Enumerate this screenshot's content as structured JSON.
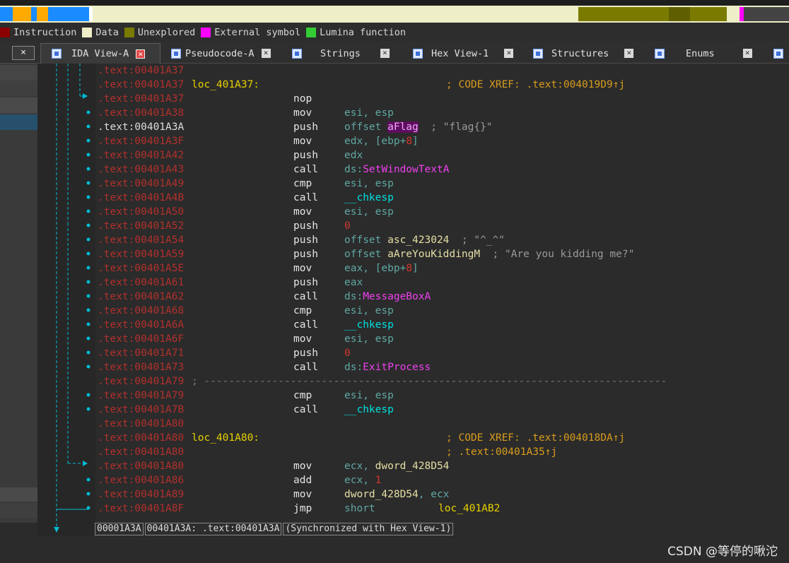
{
  "legend": [
    {
      "label": "Instruction",
      "color": "#8b0000"
    },
    {
      "label": "Data",
      "color": "#eeeec8"
    },
    {
      "label": "Unexplored",
      "color": "#7a7a00"
    },
    {
      "label": "External symbol",
      "color": "#ff00ff"
    },
    {
      "label": "Lumina function",
      "color": "#33cc33"
    }
  ],
  "left_close_label": "×",
  "tabs": [
    {
      "label": "IDA View-A",
      "active": true,
      "close": "×"
    },
    {
      "label": "Pseudocode-A",
      "active": false,
      "close": "×"
    },
    {
      "label": "Strings",
      "active": false,
      "close": "×"
    },
    {
      "label": "Hex View-1",
      "active": false,
      "close": "×"
    },
    {
      "label": "Structures",
      "active": false,
      "close": "×"
    },
    {
      "label": "Enums",
      "active": false,
      "close": "×"
    }
  ],
  "disasm": {
    "rows": [
      {
        "addr": ".text:00401A37"
      },
      {
        "addr": ".text:00401A37",
        "label": "loc_401A37:",
        "xref": "; CODE XREF: .text:004019D9↑j"
      },
      {
        "addr": ".text:00401A37",
        "mnem": "nop"
      },
      {
        "addr": ".text:00401A38",
        "mnem": "mov",
        "ops": "esi, esp"
      },
      {
        "addr": ".text:00401A3A",
        "mnem": "push",
        "ops_pre": "offset ",
        "ops_sym": "aFlag",
        "comment": "; \"flag{}\"",
        "current": true
      },
      {
        "addr": ".text:00401A3F",
        "mnem": "mov",
        "ops_pre": "edx, [ebp+",
        "ops_num": "8",
        "ops_post": "]"
      },
      {
        "addr": ".text:00401A42",
        "mnem": "push",
        "ops": "edx"
      },
      {
        "addr": ".text:00401A43",
        "mnem": "call",
        "ops_pre": "ds:",
        "ops_ext": "SetWindowTextA"
      },
      {
        "addr": ".text:00401A49",
        "mnem": "cmp",
        "ops": "esi, esp"
      },
      {
        "addr": ".text:00401A4B",
        "mnem": "call",
        "ops_fn": "__chkesp"
      },
      {
        "addr": ".text:00401A50",
        "mnem": "mov",
        "ops": "esi, esp"
      },
      {
        "addr": ".text:00401A52",
        "mnem": "push",
        "ops_num": "0"
      },
      {
        "addr": ".text:00401A54",
        "mnem": "push",
        "ops_pre": "offset ",
        "ops_sym": "asc_423024",
        "comment": "; \"^_^\""
      },
      {
        "addr": ".text:00401A59",
        "mnem": "push",
        "ops_pre": "offset ",
        "ops_sym": "aAreYouKiddingM",
        "comment": "; \"Are you kidding me?\""
      },
      {
        "addr": ".text:00401A5E",
        "mnem": "mov",
        "ops_pre": "eax, [ebp+",
        "ops_num": "8",
        "ops_post": "]"
      },
      {
        "addr": ".text:00401A61",
        "mnem": "push",
        "ops": "eax"
      },
      {
        "addr": ".text:00401A62",
        "mnem": "call",
        "ops_pre": "ds:",
        "ops_ext": "MessageBoxA"
      },
      {
        "addr": ".text:00401A68",
        "mnem": "cmp",
        "ops": "esi, esp"
      },
      {
        "addr": ".text:00401A6A",
        "mnem": "call",
        "ops_fn": "__chkesp"
      },
      {
        "addr": ".text:00401A6F",
        "mnem": "mov",
        "ops": "esi, esp"
      },
      {
        "addr": ".text:00401A71",
        "mnem": "push",
        "ops_num": "0"
      },
      {
        "addr": ".text:00401A73",
        "mnem": "call",
        "ops_pre": "ds:",
        "ops_ext": "ExitProcess"
      },
      {
        "addr": ".text:00401A79",
        "sep": "; ---------------------------------------------------------------------------"
      },
      {
        "addr": ".text:00401A79",
        "mnem": "cmp",
        "ops": "esi, esp"
      },
      {
        "addr": ".text:00401A7B",
        "mnem": "call",
        "ops_fn": "__chkesp"
      },
      {
        "addr": ".text:00401A80"
      },
      {
        "addr": ".text:00401A80",
        "label": "loc_401A80:",
        "xref": "; CODE XREF: .text:004018DA↑j"
      },
      {
        "addr": ".text:00401A80",
        "xref": "; .text:00401A35↑j"
      },
      {
        "addr": ".text:00401A80",
        "mnem": "mov",
        "ops_pre": "ecx, ",
        "ops_data": "dword_428D54"
      },
      {
        "addr": ".text:00401A86",
        "mnem": "add",
        "ops_pre": "ecx, ",
        "ops_num": "1"
      },
      {
        "addr": ".text:00401A89",
        "mnem": "mov",
        "ops_data": "dword_428D54",
        "ops_post": ", ecx"
      },
      {
        "addr": ".text:00401A8F",
        "mnem": "jmp",
        "ops_pre": "short ",
        "ops_loc": "loc_401AB2"
      }
    ]
  },
  "status": {
    "offset": "00001A3A",
    "location": "00401A3A: .text:00401A3A",
    "sync": "(Synchronized with Hex View-1)"
  },
  "watermark": "CSDN @等停的啾沱"
}
